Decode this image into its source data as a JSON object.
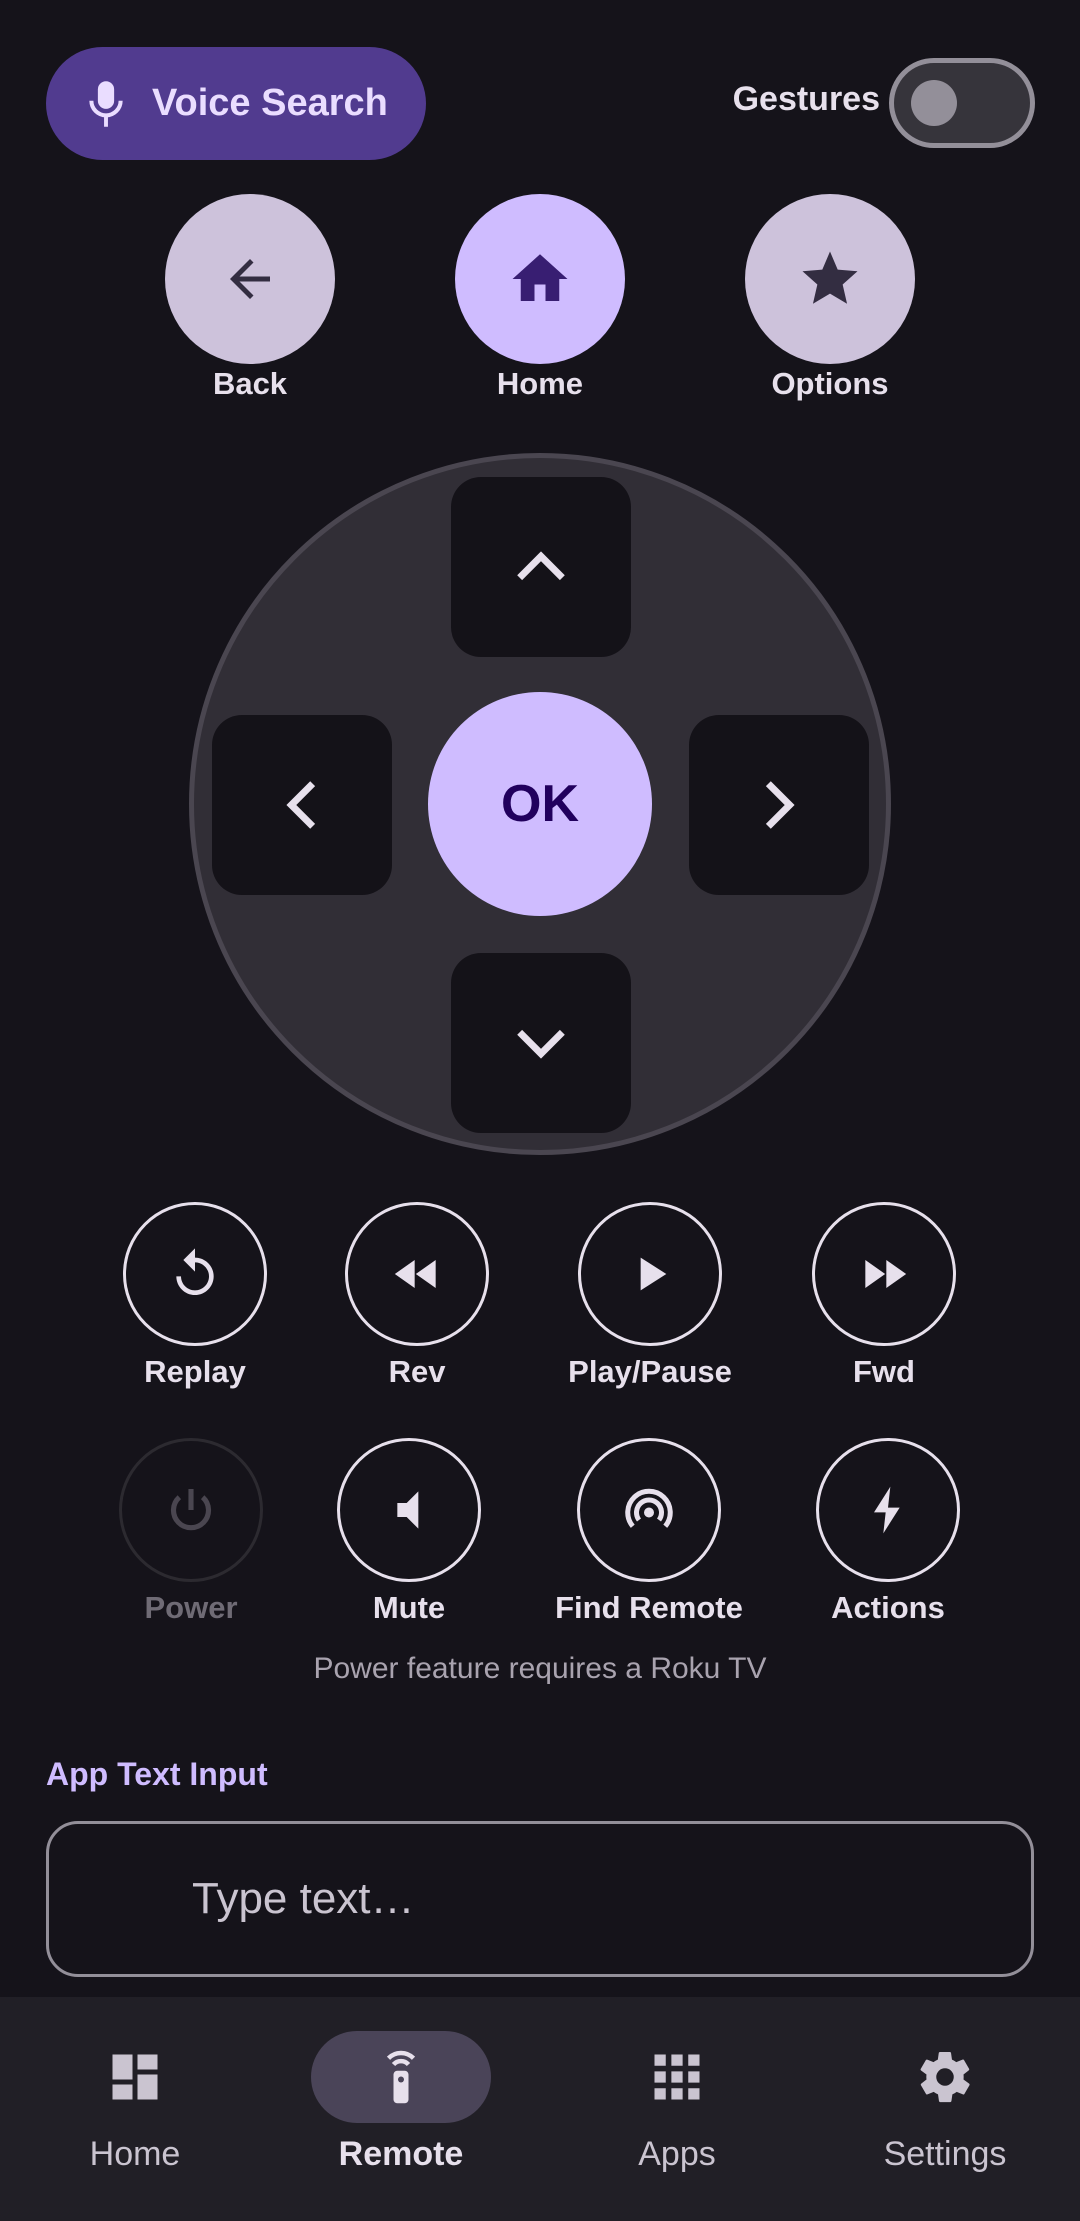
{
  "header": {
    "voice_search_label": "Voice Search",
    "gestures_label": "Gestures",
    "gestures_enabled": false
  },
  "top_buttons": [
    {
      "label": "Back",
      "icon": "arrow-back-icon"
    },
    {
      "label": "Home",
      "icon": "home-icon"
    },
    {
      "label": "Options",
      "icon": "star-icon"
    }
  ],
  "dpad": {
    "ok_label": "OK",
    "icons": [
      "chevron-up-icon",
      "chevron-left-icon",
      "chevron-right-icon",
      "chevron-down-icon"
    ]
  },
  "media_buttons": [
    {
      "label": "Replay",
      "icon": "replay-icon"
    },
    {
      "label": "Rev",
      "icon": "rewind-icon"
    },
    {
      "label": "Play/Pause",
      "icon": "play-icon"
    },
    {
      "label": "Fwd",
      "icon": "fast-forward-icon"
    }
  ],
  "utility_buttons": [
    {
      "label": "Power",
      "icon": "power-icon",
      "disabled": true
    },
    {
      "label": "Mute",
      "icon": "volume-mute-icon",
      "disabled": false
    },
    {
      "label": "Find Remote",
      "icon": "find-remote-icon",
      "disabled": false
    },
    {
      "label": "Actions",
      "icon": "bolt-icon",
      "disabled": false
    }
  ],
  "power_note": "Power feature requires a Roku TV",
  "text_input": {
    "title": "App Text Input",
    "placeholder": "Type text…",
    "value": ""
  },
  "bottom_nav": {
    "active": "Remote",
    "items": [
      {
        "label": "Home",
        "icon": "dashboard-icon"
      },
      {
        "label": "Remote",
        "icon": "remote-icon"
      },
      {
        "label": "Apps",
        "icon": "apps-grid-icon"
      },
      {
        "label": "Settings",
        "icon": "gear-icon"
      }
    ]
  },
  "colors": {
    "background": "#15131a",
    "accent": "#cfbcff",
    "voice_button": "#513b8f",
    "surface": "#312e36",
    "nav_bar": "#211f26"
  }
}
